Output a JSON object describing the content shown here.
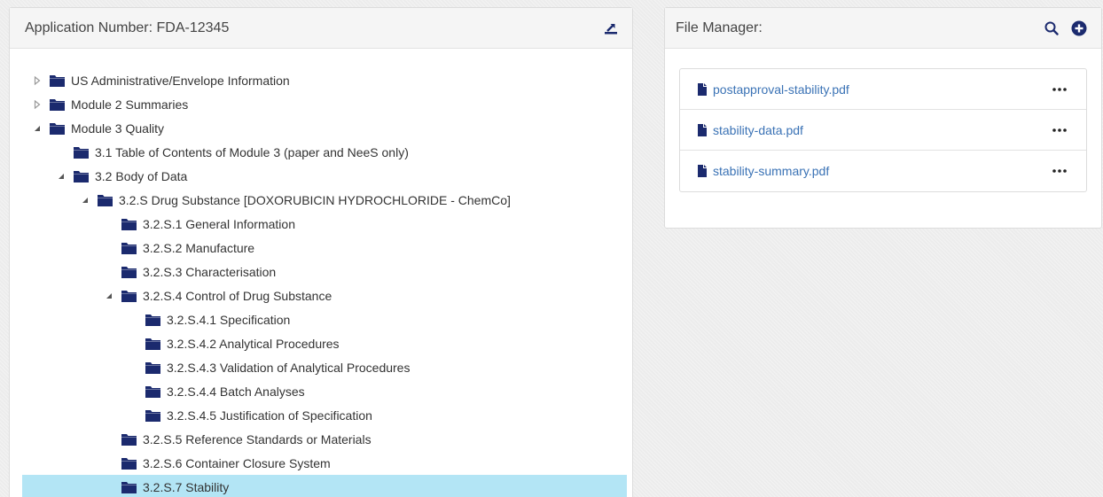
{
  "colors": {
    "folder": "#1b2a6e",
    "link": "#3a72b5",
    "selected_row": "#b3e5f5",
    "header_bg": "#f5f5f5",
    "toggle": "#555555"
  },
  "tree_panel": {
    "title": "Application Number: FDA-12345",
    "export_icon": "export-icon"
  },
  "tree": {
    "items": [
      {
        "label": "US Administrative/Envelope Information",
        "level": 0,
        "toggle": "collapsed"
      },
      {
        "label": "Module 2 Summaries",
        "level": 0,
        "toggle": "collapsed"
      },
      {
        "label": "Module 3 Quality",
        "level": 0,
        "toggle": "expanded"
      },
      {
        "label": "3.1 Table of Contents of Module 3 (paper and NeeS only)",
        "level": 1,
        "toggle": "none"
      },
      {
        "label": "3.2 Body of Data",
        "level": 1,
        "toggle": "expanded"
      },
      {
        "label": "3.2.S Drug Substance [DOXORUBICIN HYDROCHLORIDE - ChemCo]",
        "level": 2,
        "toggle": "expanded"
      },
      {
        "label": "3.2.S.1 General Information",
        "level": 3,
        "toggle": "none"
      },
      {
        "label": "3.2.S.2 Manufacture",
        "level": 3,
        "toggle": "none"
      },
      {
        "label": "3.2.S.3 Characterisation",
        "level": 3,
        "toggle": "none"
      },
      {
        "label": "3.2.S.4 Control of Drug Substance",
        "level": 3,
        "toggle": "expanded"
      },
      {
        "label": "3.2.S.4.1 Specification",
        "level": 4,
        "toggle": "none"
      },
      {
        "label": "3.2.S.4.2 Analytical Procedures",
        "level": 4,
        "toggle": "none"
      },
      {
        "label": "3.2.S.4.3 Validation of Analytical Procedures",
        "level": 4,
        "toggle": "none"
      },
      {
        "label": "3.2.S.4.4 Batch Analyses",
        "level": 4,
        "toggle": "none"
      },
      {
        "label": "3.2.S.4.5 Justification of Specification",
        "level": 4,
        "toggle": "none"
      },
      {
        "label": "3.2.S.5 Reference Standards or Materials",
        "level": 3,
        "toggle": "none"
      },
      {
        "label": "3.2.S.6 Container Closure System",
        "level": 3,
        "toggle": "none"
      },
      {
        "label": "3.2.S.7 Stability",
        "level": 3,
        "toggle": "none",
        "selected": true
      }
    ]
  },
  "file_manager": {
    "title": "File Manager:",
    "search_icon": "search-icon",
    "add_icon": "plus-circle-icon",
    "files": [
      {
        "name": "postapproval-stability.pdf"
      },
      {
        "name": "stability-data.pdf"
      },
      {
        "name": "stability-summary.pdf"
      }
    ]
  }
}
